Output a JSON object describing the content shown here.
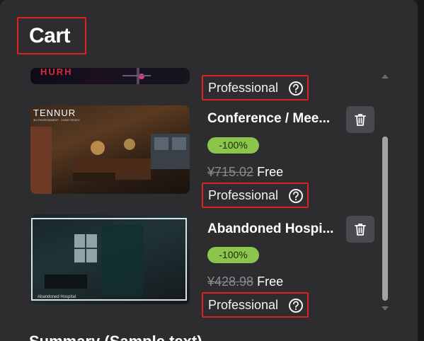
{
  "cart": {
    "title": "Cart"
  },
  "items": [
    {
      "name": "",
      "thumbnail_text": "HURH",
      "license": "Professional"
    },
    {
      "name": "Conference / Mee...",
      "thumbnail_brand": "TENNUR",
      "thumbnail_subtext": "3D ENVIRONMENT · GAME READY",
      "discount": "-100%",
      "original_price": "¥715.02",
      "price": "Free",
      "license": "Professional"
    },
    {
      "name": "Abandoned Hospi...",
      "thumbnail_caption": "Abandoned Hospital",
      "discount": "-100%",
      "original_price": "¥428.98",
      "price": "Free",
      "license": "Professional"
    }
  ],
  "footer": {
    "heading": "Summary (Sample text)"
  },
  "icons": {
    "delete": "trash-icon",
    "help": "question-circle-icon",
    "scroll_up": "chevron-up-icon",
    "scroll_down": "chevron-down-icon"
  },
  "colors": {
    "discount_badge": "#8cc54c",
    "highlight_box": "#e0201c",
    "panel": "#2d2d30"
  }
}
